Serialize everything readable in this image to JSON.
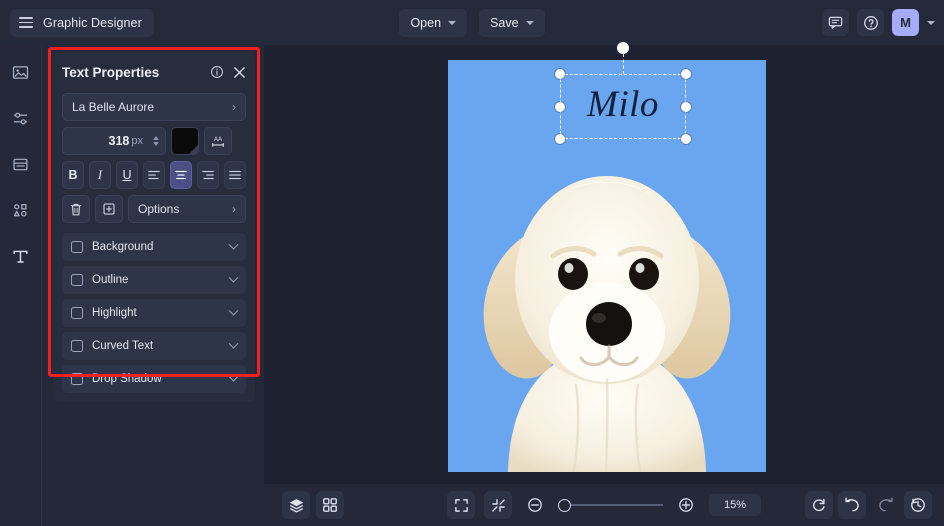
{
  "app": {
    "project_title": "Graphic Designer",
    "menu_icon": "hamburger-icon"
  },
  "topbar": {
    "open_label": "Open",
    "save_label": "Save",
    "comment_icon": "comment-icon",
    "help_icon": "help-circle-icon",
    "avatar_initial": "M",
    "account_caret": "chevron-down-icon"
  },
  "rail": {
    "items": [
      {
        "name": "image-icon",
        "label": "Image"
      },
      {
        "name": "adjustments-icon",
        "label": "Adjust"
      },
      {
        "name": "layout-icon",
        "label": "Layout"
      },
      {
        "name": "shapes-icon",
        "label": "Elements"
      },
      {
        "name": "text-icon",
        "label": "Text"
      }
    ]
  },
  "panel": {
    "title": "Text Properties",
    "info_icon": "info-icon",
    "close_icon": "close-icon",
    "font_name": "La Belle Aurore",
    "font_chevron": "chevron-right-icon",
    "font_size": "318",
    "font_size_unit": "px",
    "color_swatch": "#0b0b0b",
    "letter_spacing_icon": "letter-spacing-icon",
    "bold_label": "B",
    "italic_label": "I",
    "underline_label": "U",
    "align_left_icon": "align-left-icon",
    "align_center_icon": "align-center-icon",
    "align_right_icon": "align-right-icon",
    "align_justify_icon": "align-justify-icon",
    "active_alignment": "center",
    "delete_icon": "trash-icon",
    "duplicate_icon": "duplicate-icon",
    "options_label": "Options",
    "options_chevron": "chevron-right-icon",
    "sections": [
      {
        "label": "Background",
        "checked": false
      },
      {
        "label": "Outline",
        "checked": false
      },
      {
        "label": "Highlight",
        "checked": false
      },
      {
        "label": "Curved Text",
        "checked": false
      },
      {
        "label": "Drop Shadow",
        "checked": false
      }
    ],
    "highlight_color": "#f21f1f"
  },
  "canvas": {
    "artboard_background": "#6aa6f0",
    "selected_text": "Milo",
    "selection_handles": 8,
    "artwork": "golden-retriever-puppy"
  },
  "bottombar": {
    "layers_icon": "layers-icon",
    "grid_icon": "grid-icon",
    "fit_icon": "fit-screen-icon",
    "collapse_icon": "collapse-icon",
    "zoom_out_icon": "zoom-out-icon",
    "zoom_in_icon": "zoom-in-icon",
    "zoom_level": "15%",
    "refresh_icon": "refresh-icon",
    "undo_icon": "undo-icon",
    "redo_icon": "redo-icon",
    "history_icon": "history-icon"
  }
}
